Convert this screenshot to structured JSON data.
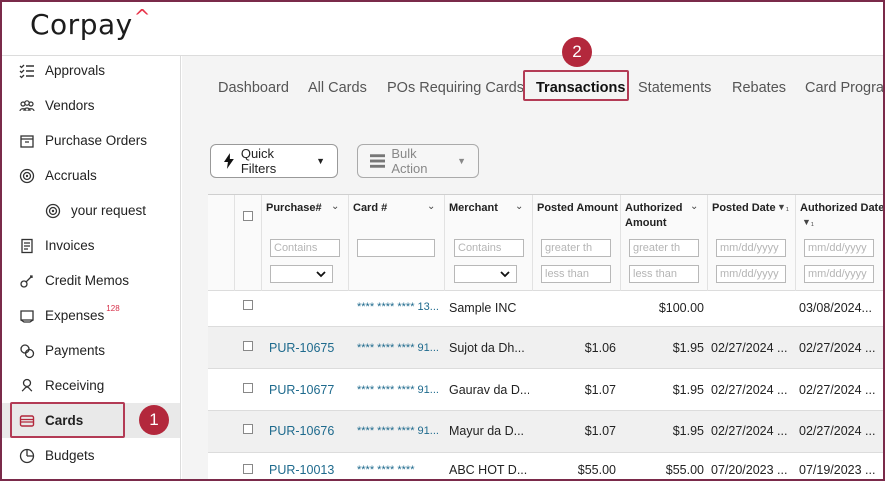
{
  "brand": {
    "name": "Corpay",
    "mark": "^"
  },
  "sidebar": {
    "items": [
      {
        "id": "approvals",
        "label": "Approvals",
        "icon": "checklist-icon"
      },
      {
        "id": "vendors",
        "label": "Vendors",
        "icon": "people-icon"
      },
      {
        "id": "purchase-orders",
        "label": "Purchase Orders",
        "icon": "box-icon"
      },
      {
        "id": "accruals",
        "label": "Accruals",
        "icon": "target-icon"
      },
      {
        "id": "your-request",
        "label": "your request",
        "icon": "target-icon"
      },
      {
        "id": "invoices",
        "label": "Invoices",
        "icon": "invoice-icon"
      },
      {
        "id": "credit-memos",
        "label": "Credit Memos",
        "icon": "dollar-key-icon"
      },
      {
        "id": "expenses",
        "label": "Expenses",
        "icon": "receipt-icon",
        "badge": "128"
      },
      {
        "id": "payments",
        "label": "Payments",
        "icon": "coins-icon"
      },
      {
        "id": "receiving",
        "label": "Receiving",
        "icon": "hand-icon"
      },
      {
        "id": "cards",
        "label": "Cards",
        "icon": "card-icon"
      },
      {
        "id": "budgets",
        "label": "Budgets",
        "icon": "pie-icon"
      }
    ],
    "active": "Cards"
  },
  "tabs": [
    "Dashboard",
    "All Cards",
    "POs Requiring Cards",
    "Transactions",
    "Statements",
    "Rebates",
    "Card Program"
  ],
  "active_tab": "Transactions",
  "callouts": {
    "one": "1",
    "two": "2"
  },
  "toolbar": {
    "quick_filters": "Quick Filters",
    "bulk_action": "Bulk Action"
  },
  "grid": {
    "headers": {
      "purchase": "Purchase#",
      "card": "Card #",
      "merchant": "Merchant",
      "posted_amount": "Posted Amount",
      "authorized_amount_1": "Authorized",
      "authorized_amount_2": "Amount",
      "posted_date": "Posted Date",
      "authorized_date": "Authorized Date"
    },
    "filters": {
      "purchase": "Contains",
      "merchant": "Contains",
      "posted_gt": "greater th",
      "posted_lt": "less than",
      "auth_gt": "greater th",
      "auth_lt": "less than",
      "pdate_from": "mm/dd/yyyy",
      "pdate_to": "mm/dd/yyyy",
      "adate_from": "mm/dd/yyyy",
      "adate_to": "mm/dd/yyyy"
    },
    "rows": [
      {
        "purchase": "",
        "card": "**** **** **** 13...",
        "merchant": "Sample INC",
        "posted": "",
        "authorized": "$100.00",
        "posted_date": "",
        "authorized_date": "03/08/2024..."
      },
      {
        "purchase": "PUR-10675",
        "card": "**** **** **** 91...",
        "merchant": "Sujot da Dh...",
        "posted": "$1.06",
        "authorized": "$1.95",
        "posted_date": "02/27/2024 ...",
        "authorized_date": "02/27/2024 ..."
      },
      {
        "purchase": "PUR-10677",
        "card": "**** **** **** 91...",
        "merchant": "Gaurav da D...",
        "posted": "$1.07",
        "authorized": "$1.95",
        "posted_date": "02/27/2024 ...",
        "authorized_date": "02/27/2024 ..."
      },
      {
        "purchase": "PUR-10676",
        "card": "**** **** **** 91...",
        "merchant": "Mayur da D...",
        "posted": "$1.07",
        "authorized": "$1.95",
        "posted_date": "02/27/2024 ...",
        "authorized_date": "02/27/2024 ..."
      },
      {
        "purchase": "PUR-10013",
        "card": "**** **** ****",
        "merchant": "ABC HOT D...",
        "posted": "$55.00",
        "authorized": "$55.00",
        "posted_date": "07/20/2023 ...",
        "authorized_date": "07/19/2023 ..."
      }
    ]
  },
  "colors": {
    "accent": "#b3283c",
    "link": "#1e6a8d",
    "brand_mark": "#e8344a"
  }
}
